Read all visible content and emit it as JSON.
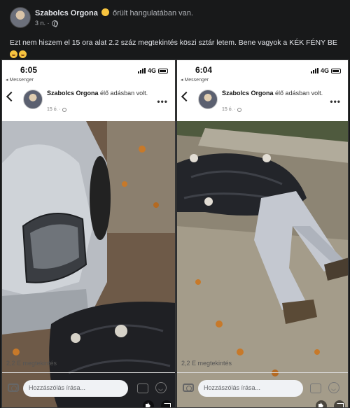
{
  "post": {
    "author": "Szabolcs Orgona",
    "feeling": "őrült hangulatában van.",
    "time": "3 n. ·",
    "text": "Ezt nem hiszem el 15 ora alat 2.2 száz megtekintés köszi sztár letem. Bene vagyok a KÉK FÉNY BE"
  },
  "screenshots": [
    {
      "time": "6:05",
      "network": "4G",
      "back_app": "◂ Messenger",
      "author": "Szabolcs Orgona",
      "status": "élő adásban volt.",
      "age": "15 ó. ·",
      "views": "2,2 E megtekintés",
      "comment_placeholder": "Hozzászólás írása..."
    },
    {
      "time": "6:04",
      "network": "4G",
      "back_app": "◂ Messenger",
      "author": "Szabolcs Orgona",
      "status": "élő adásban volt.",
      "age": "15 ó. ·",
      "views": "2,2 E megtekintés",
      "comment_placeholder": "Hozzászólás írása..."
    }
  ],
  "icons": [
    "camera-icon",
    "gif-icon",
    "smile-icon",
    "sound-icon",
    "fullscreen-icon",
    "more-icon",
    "globe-icon"
  ],
  "colors": {
    "background": "#18191a",
    "frame": "#ffffff",
    "emoji": "#f7c43f"
  }
}
